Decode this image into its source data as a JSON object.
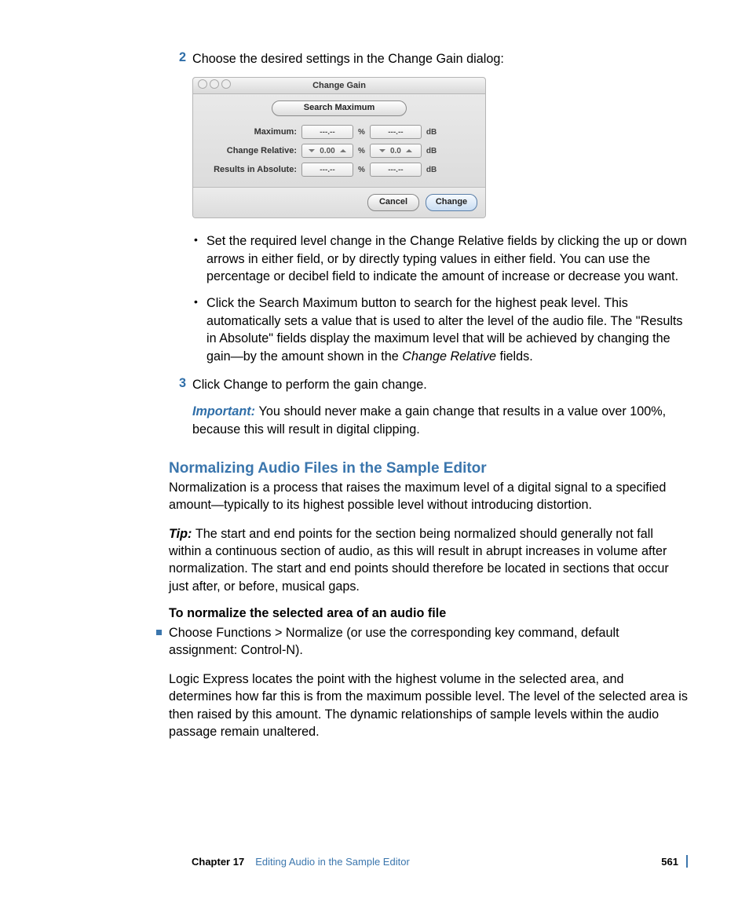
{
  "steps": {
    "two": {
      "num": "2",
      "text": "Choose the desired settings in the Change Gain dialog:"
    },
    "three": {
      "num": "3",
      "text": "Click Change to perform the gain change."
    }
  },
  "dialog": {
    "title": "Change Gain",
    "search_max": "Search Maximum",
    "rows": {
      "maximum": {
        "label": "Maximum:",
        "pct_val": "---.--",
        "pct_unit": "%",
        "db_val": "---.--",
        "db_unit": "dB"
      },
      "relative": {
        "label": "Change Relative:",
        "pct_val": "0.00",
        "pct_unit": "%",
        "db_val": "0.0",
        "db_unit": "dB"
      },
      "absolute": {
        "label": "Results in Absolute:",
        "pct_val": "---.--",
        "pct_unit": "%",
        "db_val": "---.--",
        "db_unit": "dB"
      }
    },
    "buttons": {
      "cancel": "Cancel",
      "change": "Change"
    }
  },
  "sub_bullets": {
    "b1": "Set the required level change in the Change Relative fields by clicking the up or down arrows in either field, or by directly typing values in either field. You can use the percentage or decibel field to indicate the amount of increase or decrease you want.",
    "b2_a": "Click the Search Maximum button to search for the highest peak level. This automatically sets a value that is used to alter the level of the audio file. The \"Results in Absolute\" fields display the maximum level that will be achieved by changing the gain—by the amount shown in the ",
    "b2_italic": "Change Relative",
    "b2_c": " fields."
  },
  "important": {
    "label": "Important:  ",
    "text": "You should never make a gain change that results in a value over 100%, because this will result in digital clipping."
  },
  "heading": "Normalizing Audio Files in the Sample Editor",
  "para1": "Normalization is a process that raises the maximum level of a digital signal to a specified amount—typically to its highest possible level without introducing distortion.",
  "tip": {
    "label": "Tip:  ",
    "text": "The start and end points for the section being normalized should generally not fall within a continuous section of audio, as this will result in abrupt increases in volume after normalization. The start and end points should therefore be located in sections that occur just after, or before, musical gaps."
  },
  "subheading": "To normalize the selected area of an audio file",
  "blue_bullet": "Choose Functions > Normalize (or use the corresponding key command, default assignment:  Control-N).",
  "para2": "Logic Express locates the point with the highest volume in the selected area, and determines how far this is from the maximum possible level. The level of the selected area is then raised by this amount. The dynamic relationships of sample levels within the audio passage remain unaltered.",
  "footer": {
    "chapter_num": "Chapter 17",
    "chapter_title": "Editing Audio in the Sample Editor",
    "page": "561"
  }
}
